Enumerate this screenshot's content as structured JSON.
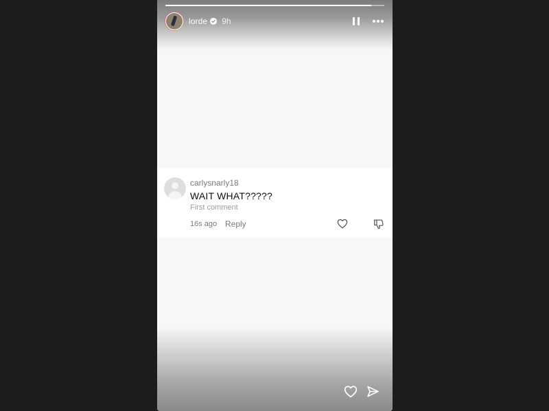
{
  "story": {
    "progress": 0.94,
    "account": {
      "username": "lorde",
      "verified": true,
      "posted_ago": "9h"
    },
    "controls": {
      "pause_icon": "pause-icon",
      "more_icon": "more-options-icon"
    }
  },
  "comment": {
    "username": "carlysnarly18",
    "text": "WAIT WHAT?????",
    "meta": "First comment",
    "age": "16s ago",
    "reply_label": "Reply",
    "like_icon": "heart-outline-icon",
    "dislike_icon": "thumbs-down-icon"
  },
  "footer": {
    "like_icon": "heart-outline-icon",
    "share_icon": "paper-plane-icon"
  },
  "colors": {
    "background": "#1c1c1c",
    "story_surface": "#f7f7f7",
    "card": "#ffffff",
    "primary_text": "#111111",
    "secondary_text": "#7a7a7a",
    "icon_light": "#ffffff",
    "icon_dark": "#555555"
  }
}
